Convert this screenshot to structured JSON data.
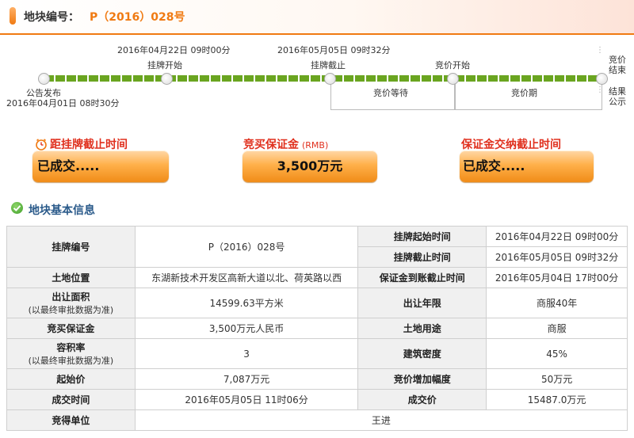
{
  "header": {
    "label": "地块编号：",
    "code": "P（2016）028号",
    "accent_color": "#f07a12"
  },
  "timeline": {
    "announce_label": "公告发布",
    "announce_time": "2016年04月01日  08时30分",
    "listing_start_label": "挂牌开始",
    "listing_start_time": "2016年04月22日  09时00分",
    "listing_end_label": "挂牌截止",
    "listing_end_time": "2016年05月05日  09时32分",
    "bid_wait_label": "竞价等待",
    "bid_start_label": "竞价开始",
    "bid_period_label": "竞价期",
    "bid_end_label_1": "竞价",
    "bid_end_label_2": "结束",
    "result_label_1": "结果",
    "result_label_2": "公示"
  },
  "countdown": {
    "listing_deadline_title": "距挂牌截止时间",
    "listing_deadline_value": "已成交.....",
    "deposit_title": "竞买保证金",
    "deposit_unit": "(RMB)",
    "deposit_value": "3,500万元",
    "deposit_deadline_title": "保证金交纳截止时间",
    "deposit_deadline_value": "已成交....."
  },
  "section": {
    "title": "地块基本信息"
  },
  "table": {
    "listing_no_label": "挂牌编号",
    "listing_no_value": "P（2016）028号",
    "listing_start_label": "挂牌起始时间",
    "listing_start_value": "2016年04月22日  09时00分",
    "listing_end_label": "挂牌截止时间",
    "listing_end_value": "2016年05月05日  09时32分",
    "location_label": "土地位置",
    "location_value": "东湖新技术开发区高新大道以北、荷英路以西",
    "deposit_deadline_label": "保证金到账截止时间",
    "deposit_deadline_value": "2016年05月04日  17时00分",
    "area_label": "出让面积",
    "area_note": "(以最终审批数据为准)",
    "area_value": "14599.63平方米",
    "term_label": "出让年限",
    "term_value": "商服40年",
    "deposit_label": "竞买保证金",
    "deposit_value": "3,500万元人民币",
    "use_label": "土地用途",
    "use_value": "商服",
    "far_label": "容积率",
    "far_note": "(以最终审批数据为准)",
    "far_value": "3",
    "density_label": "建筑密度",
    "density_value": "45%",
    "start_price_label": "起始价",
    "start_price_value": "7,087万元",
    "increment_label": "竞价增加幅度",
    "increment_value": "50万元",
    "deal_time_label": "成交时间",
    "deal_time_value": "2016年05月05日  11时06分",
    "deal_price_label": "成交价",
    "deal_price_value": "15487.0万元",
    "winner_label": "竞得单位",
    "winner_value": "王进"
  }
}
